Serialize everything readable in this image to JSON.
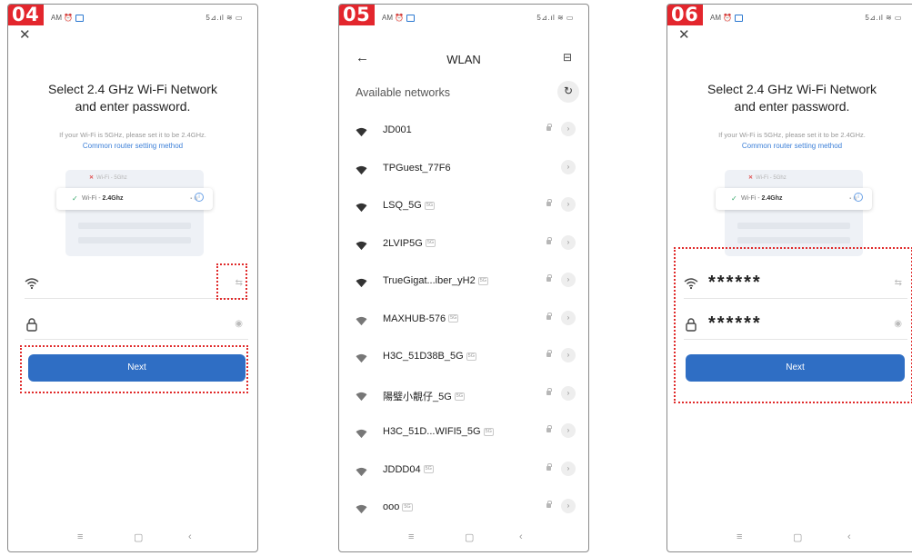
{
  "status": {
    "time": "AM",
    "right": "5⊿.ıl ≋ ▭"
  },
  "screen1": {
    "step": "04",
    "close": "✕",
    "title_line1": "Select 2.4 GHz Wi-Fi Network",
    "title_line2": "and enter password.",
    "hint": "If your Wi-Fi is 5GHz, please set it to be 2.4GHz.",
    "link": "Common router setting method",
    "illus_5g": "Wi-Fi - 5Ghz",
    "illus_24_prefix": "Wi-Fi - ",
    "illus_24_band": "2.4Ghz",
    "ssid_value": "",
    "password_value": "",
    "next_label": "Next"
  },
  "screen2": {
    "step": "05",
    "back": "←",
    "title": "WLAN",
    "scan": "⊟",
    "available_label": "Available networks",
    "refresh": "↻",
    "networks": [
      {
        "name": "JD001",
        "badge": "",
        "locked": true
      },
      {
        "name": "TPGuest_77F6",
        "badge": "",
        "locked": false
      },
      {
        "name": "LSQ_5G",
        "badge": "5G",
        "locked": true
      },
      {
        "name": "2LVIP5G",
        "badge": "5G",
        "locked": true
      },
      {
        "name": "TrueGigat...iber_yH2",
        "badge": "5G",
        "locked": true
      },
      {
        "name": "MAXHUB-576",
        "badge": "5G",
        "locked": true
      },
      {
        "name": "H3C_51D38B_5G",
        "badge": "5G",
        "locked": true
      },
      {
        "name": "陽璧小靚仔_5G",
        "badge": "5G",
        "locked": true
      },
      {
        "name": "H3C_51D...WIFI5_5G",
        "badge": "5G",
        "locked": true
      },
      {
        "name": "JDDD04",
        "badge": "5G",
        "locked": true
      },
      {
        "name": "ooo",
        "badge": "5G",
        "locked": true
      }
    ]
  },
  "screen3": {
    "step": "06",
    "close": "✕",
    "title_line1": "Select 2.4 GHz Wi-Fi Network",
    "title_line2": "and enter password.",
    "hint": "If your Wi-Fi is 5GHz, please set it to be 2.4GHz.",
    "link": "Common router setting method",
    "illus_5g": "Wi-Fi - 5Ghz",
    "illus_24_prefix": "Wi-Fi - ",
    "illus_24_band": "2.4Ghz",
    "ssid_value": "******",
    "password_value": "******",
    "next_label": "Next"
  },
  "nav": {
    "menu": "≡",
    "home": "▢",
    "back": "‹"
  },
  "colors": {
    "accent": "#2f6ec4",
    "link": "#3d80d8",
    "highlight": "#e02b2b",
    "badge": "#e3262d"
  }
}
